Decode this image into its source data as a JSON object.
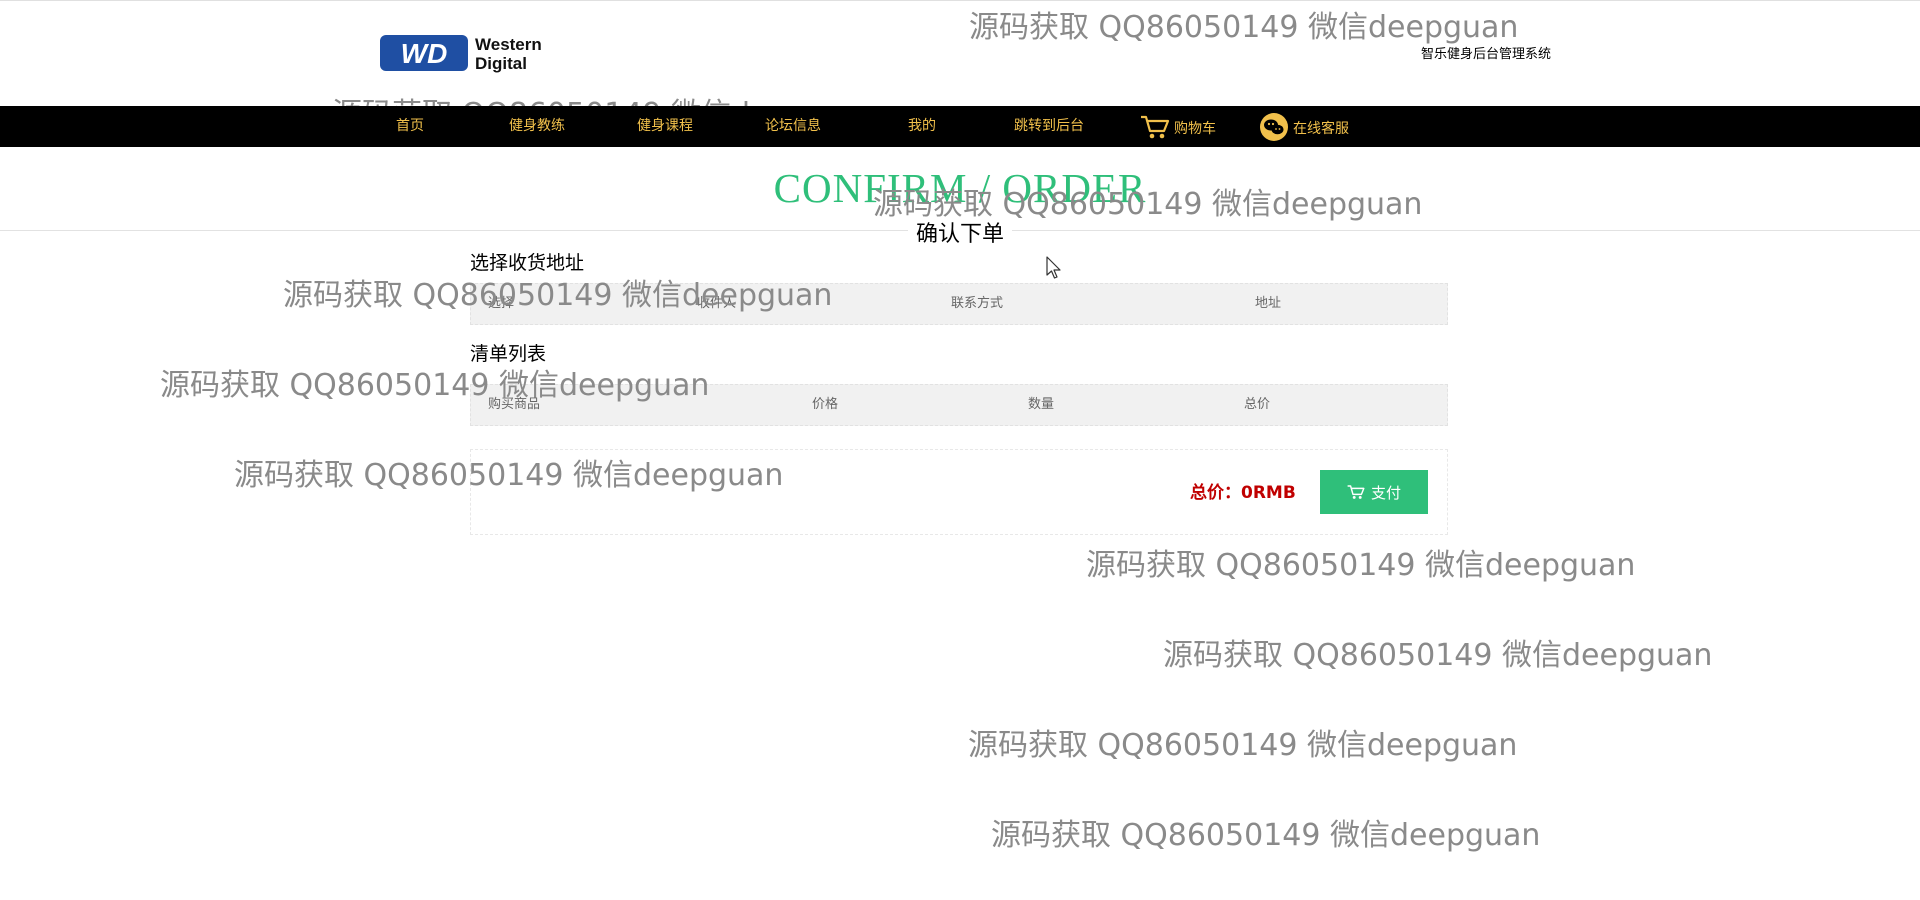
{
  "header": {
    "logo_text_line1": "Western",
    "logo_text_line2": "Digital",
    "logo_mark": "WD",
    "system_title": "智乐健身后台管理系统"
  },
  "nav": {
    "items": [
      {
        "label": "首页"
      },
      {
        "label": "健身教练"
      },
      {
        "label": "健身课程"
      },
      {
        "label": "论坛信息"
      },
      {
        "label": "我的"
      },
      {
        "label": "跳转到后台"
      },
      {
        "label": "购物车",
        "icon": "cart-icon"
      },
      {
        "label": "在线客服",
        "icon": "wechat-icon"
      }
    ]
  },
  "page": {
    "title": "CONFIRM / ORDER",
    "subtitle": "确认下单"
  },
  "address": {
    "label": "选择收货地址",
    "columns": [
      "选择",
      "收件人",
      "联系方式",
      "地址"
    ]
  },
  "order_list": {
    "label": "清单列表",
    "columns": [
      "购买商品",
      "价格",
      "数量",
      "总价"
    ]
  },
  "summary": {
    "total_price": "总价：0RMB",
    "pay_label": "支付",
    "pay_icon": "cart-icon"
  },
  "watermark": {
    "text": "源码获取 QQ86050149 微信deepguan"
  },
  "colors": {
    "nav_bg": "#000000",
    "nav_text": "#f1c04b",
    "accent": "#2fbf7a",
    "price": "#c00000"
  }
}
